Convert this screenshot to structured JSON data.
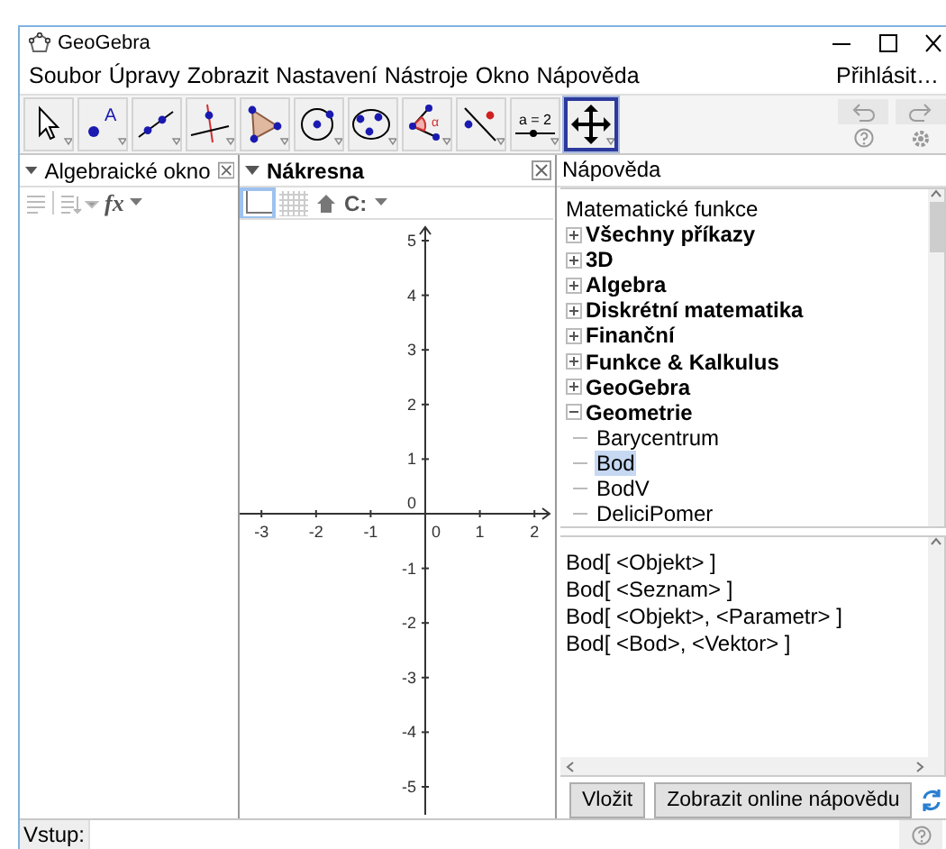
{
  "window": {
    "title": "GeoGebra"
  },
  "menu": [
    {
      "label": "Soubor"
    },
    {
      "label": "Úpravy"
    },
    {
      "label": "Zobrazit"
    },
    {
      "label": "Nastavení"
    },
    {
      "label": "Nástroje"
    },
    {
      "label": "Okno"
    },
    {
      "label": "Nápověda"
    }
  ],
  "sign_in": "Přihlásit…",
  "toolbar": {
    "tools": [
      {
        "kind": "move",
        "selected": false
      },
      {
        "kind": "point",
        "label": "A",
        "selected": false
      },
      {
        "kind": "line",
        "selected": false
      },
      {
        "kind": "perpendicular",
        "selected": false
      },
      {
        "kind": "polygon",
        "selected": false
      },
      {
        "kind": "circle",
        "selected": false
      },
      {
        "kind": "conic",
        "selected": false
      },
      {
        "kind": "angle",
        "label": "α",
        "selected": false
      },
      {
        "kind": "reflect",
        "selected": false
      },
      {
        "kind": "slider",
        "label": "a = 2",
        "selected": false
      },
      {
        "kind": "move-view",
        "selected": true
      }
    ],
    "history": [
      {
        "kind": "undo",
        "disabled": true
      },
      {
        "kind": "redo",
        "disabled": true
      }
    ]
  },
  "algebra": {
    "title": "Algebraické okno",
    "fx": "fx"
  },
  "graphics": {
    "title": "Nákresna",
    "axes": true,
    "grid": false,
    "capture": "C:",
    "x_ticks": [
      "-3",
      "-2",
      "-1",
      "0",
      "1",
      "2"
    ],
    "y_ticks": [
      "5",
      "4",
      "3",
      "2",
      "1",
      "0",
      "-1",
      "-2",
      "-3",
      "-4",
      "-5"
    ]
  },
  "help": {
    "title": "Nápověda",
    "tree": {
      "label": "Matematické funkce",
      "children": [
        {
          "label": "Všechny příkazy",
          "expanded": false
        },
        {
          "label": "3D",
          "expanded": false
        },
        {
          "label": "Algebra",
          "expanded": false
        },
        {
          "label": "Diskrétní matematika",
          "expanded": false
        },
        {
          "label": "Finanční",
          "expanded": false
        },
        {
          "label": "Funkce & Kalkulus",
          "expanded": false
        },
        {
          "label": "GeoGebra",
          "expanded": false
        },
        {
          "label": "Geometrie",
          "expanded": true,
          "children": [
            {
              "label": "Barycentrum",
              "selected": false
            },
            {
              "label": "Bod",
              "selected": true
            },
            {
              "label": "BodV",
              "selected": false
            },
            {
              "label": "DeliciPomer",
              "selected": false
            }
          ]
        }
      ]
    },
    "syntax": [
      "Bod[ <Objekt> ]",
      "Bod[ <Seznam> ]",
      "Bod[ <Objekt>, <Parametr> ]",
      "Bod[ <Bod>, <Vektor> ]"
    ],
    "buttons": [
      "Vložit",
      "Zobrazit online nápovědu"
    ]
  },
  "input_bar": {
    "label": "Vstup:"
  }
}
